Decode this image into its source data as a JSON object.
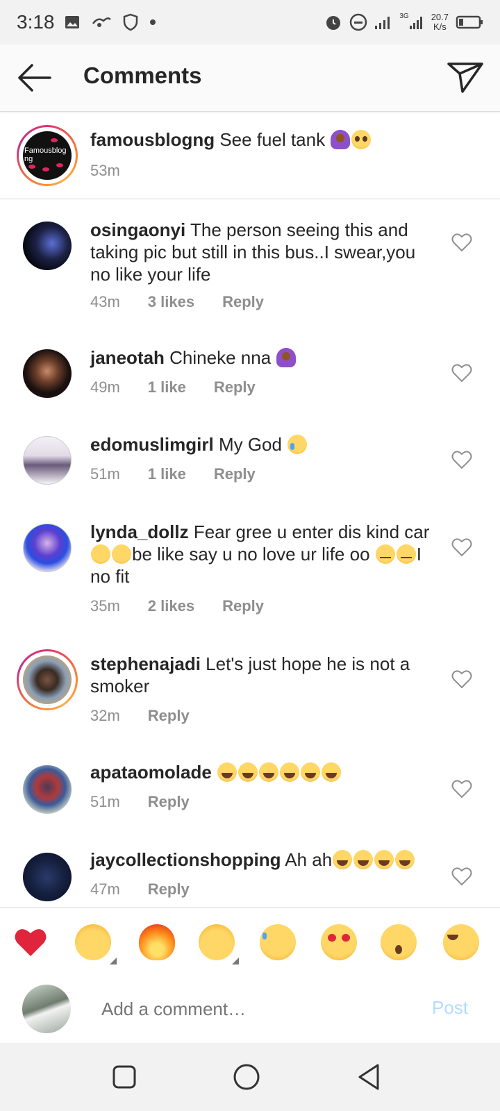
{
  "status_bar": {
    "time": "3:18",
    "network": "3G",
    "speed_value": "20.7",
    "speed_unit": "K/s"
  },
  "header": {
    "title": "Comments"
  },
  "caption": {
    "username": "famousblogng",
    "text": "See fuel tank",
    "time": "53m",
    "avatar_label": "Famousblog ng"
  },
  "comments": [
    {
      "username": "osingaonyi",
      "text": "The person seeing this and taking pic but still in this bus..I swear,you no like your life",
      "time": "43m",
      "likes": "3 likes",
      "reply": "Reply"
    },
    {
      "username": "janeotah",
      "text": "Chineke nna",
      "time": "49m",
      "likes": "1 like",
      "reply": "Reply"
    },
    {
      "username": "edomuslimgirl",
      "text": "My God",
      "time": "51m",
      "likes": "1 like",
      "reply": "Reply"
    },
    {
      "username": "lynda_dollz",
      "text_a": "Fear gree u enter dis kind car",
      "text_b": "be like say u no love ur life oo",
      "text_c": "I no fit",
      "time": "35m",
      "likes": "2 likes",
      "reply": "Reply"
    },
    {
      "username": "stephenajadi",
      "text": "Let's just hope he is not a smoker",
      "time": "32m",
      "reply": "Reply"
    },
    {
      "username": "apataomolade",
      "time": "51m",
      "reply": "Reply"
    },
    {
      "username": "jaycollectionshopping",
      "text": "Ah ah",
      "time": "47m",
      "reply": "Reply"
    }
  ],
  "emoji_bar": [
    "heart",
    "raised-hands",
    "fire",
    "clapping-hands",
    "crying-face",
    "heart-eyes-face",
    "astonished-face",
    "tears-of-joy-face"
  ],
  "add_comment": {
    "placeholder": "Add a comment…",
    "post_label": "Post"
  },
  "colors": {
    "accent_blue_disabled": "#b3dbff",
    "secondary_text": "#8e8e8e",
    "primary_text": "#262626"
  }
}
